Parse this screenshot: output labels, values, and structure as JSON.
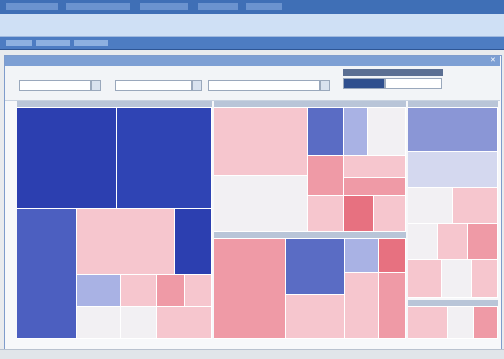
{
  "window": {
    "title": "",
    "status_text": "",
    "tab_labels": []
  },
  "filters": [
    {
      "label": "",
      "value": ""
    },
    {
      "label": "",
      "value": ""
    },
    {
      "label": "",
      "value": ""
    },
    {
      "label": "",
      "value": ""
    }
  ],
  "treemap": {
    "groups": [
      {
        "label": ""
      },
      {
        "label": ""
      },
      {
        "label": ""
      },
      {
        "label": ""
      },
      {
        "label": ""
      }
    ],
    "colors": {
      "dark_blue": "#2c3fb0",
      "mid_blue": "#5a6cc4",
      "light_blue": "#a9b2e4",
      "pale": "#f2f0f3",
      "light_pink": "#f6c6ce",
      "mid_pink": "#ef9aa6",
      "dark_pink": "#e77180"
    }
  }
}
